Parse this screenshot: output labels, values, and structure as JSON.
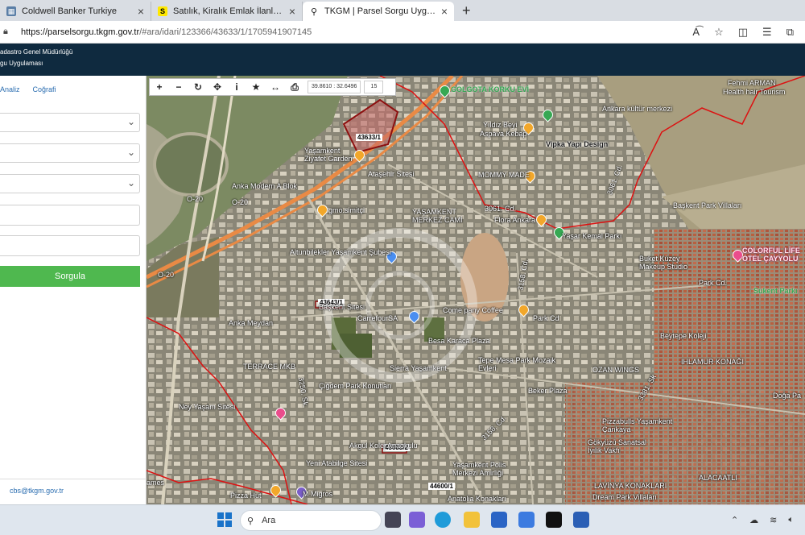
{
  "browser": {
    "tabs": [
      {
        "title": "Coldwell Banker Turkiye",
        "favicon": "coldwell-favicon",
        "color": "#5a7ea6"
      },
      {
        "title": "Satılık, Kiralık Emlak İlanları sahibi...",
        "favicon": "sahibinden-favicon",
        "color": "#ffe800"
      },
      {
        "title": "TKGM | Parsel Sorgu Uygulaması",
        "favicon": "map-pin-favicon",
        "color": "#222222"
      }
    ],
    "new_tab": "+",
    "url_host": "https://parselsorgu.tkgm.gov.tr",
    "url_path": "/#ara/idari/123366/43633/1/1705941907145"
  },
  "app": {
    "header_line1": "adastro Genel Müdürlüğü",
    "header_line2": "gu Uygulaması"
  },
  "panel": {
    "tab_analysis": "Analiz",
    "tab_geo": "Coğrafi",
    "query_button": "Sorgula",
    "email": "cbs@tkgm.gov.tr"
  },
  "map": {
    "coordinates": "39.8610 : 32.6496",
    "zoom": "15",
    "labels": {
      "golgota": "GOLGOTA KORKU EVİ",
      "fehmi": "Fehmi ARMAN",
      "health": "Health hair Tourism",
      "ankara_kultur": "Ankara kültür merkezi",
      "yildiz": "Yıldız Beyi",
      "aspava": "Aspava Kebap",
      "vipka": "Vipka Yapı Design",
      "yasamkent_ziyafet": "Yaşamkent Ziyafet Garden",
      "mommy": "MOMMY MADE",
      "atasehir": "Ataşehir Sitesi",
      "anka_blok": "Anka Modern A Blok",
      "gmo": "gmo.simitçi",
      "merkez_cami": "YAŞAMKENT MERKEZ CAMİ",
      "flora": "Flora Ankara",
      "yasar_kemal": "Yaşar Kemal Parkı",
      "baskent_park": "Başkent Park Villaları",
      "cd_3061a": "3061. Cd.",
      "cd_3061b": "3061. Cd.",
      "buket": "Buket Küzey Makeup Studio",
      "colorful": "COLORFUL LİFE OTEL ÇAYYOLU",
      "sukent": "Sukent Parkı",
      "park_cd1": "Park Cd.",
      "park_cd2": "Park Cd",
      "altunbilekler": "Altunbilekler Yaşamkent Şubesi",
      "cd_3158": "3158. Cd.",
      "baskent_sitesi": "Başkent Sitesi",
      "company": "Come pany Coffee",
      "anka_meydan": "Anka Meydan",
      "carrefour": "CarrefourSA",
      "besa": "Besa Karaca Plaza",
      "beytepe": "Beytepe Koleji",
      "tepe_mesa": "Tepe Mesa Park Mozaik Evleri",
      "terrace": "TERRACE MKB",
      "sierra": "Sierra Yaşamkent",
      "ozan": "OZAN WINGS",
      "ihlamur": "IHLAMUR KONAĞI",
      "cigdem": "Çiğdem Park Konutları",
      "beker": "Beker Plaza",
      "cd_3381": "3381. Sk",
      "doga": "Doğa Pa",
      "neyasam": "Ney Yaşam Sitesi",
      "sk_3250": "3250. Sk.",
      "pizzabulls": "Pizzabulls Yaşamkent Çankaya",
      "akgul": "Akgül Kolej Anaokulu",
      "gokyuzu": "Gökyüzü Sanatsal İyilik Vakfı",
      "cd_3158b": "3158. Cd.",
      "yeni_atabilge": "Yeni Atabilge Sitesi",
      "yasamkent_polis": "Yaşamkent Polis Merkezi Amirliği",
      "lavinya": "LAVİNYA KONAKLARI",
      "alacaatli": "ALACAATLI",
      "pizza_hut": "Pizza Hut",
      "migros": "M Migros",
      "anatolia": "Anatolia Konakları",
      "dream": "Dream Park Villaları",
      "ames": "ames",
      "road_o20a": "O-20",
      "road_o20b": "O-20",
      "road_o20c": "O-20"
    },
    "parcels": {
      "main": "43633/1",
      "p2": "43643/1",
      "p3": "43683/2",
      "p4": "44600/1"
    }
  },
  "taskbar": {
    "search_placeholder": "Ara"
  }
}
